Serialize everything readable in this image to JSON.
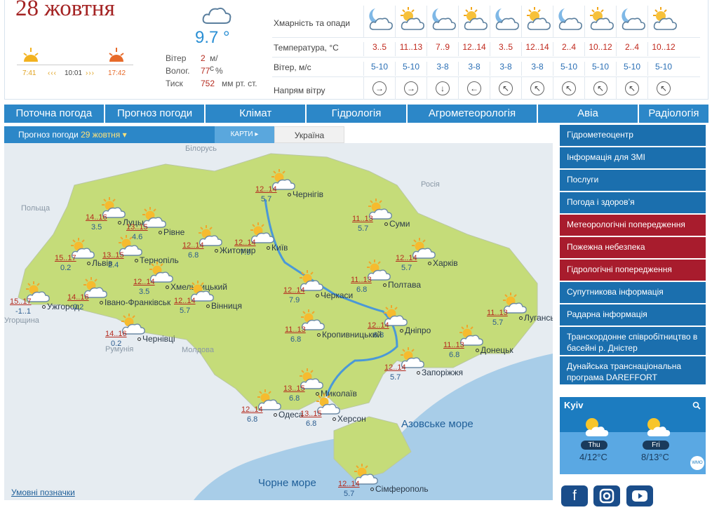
{
  "current": {
    "date": "28 жовтня",
    "temp": "9.7 °",
    "wind_label": "Вітер",
    "wind_value": "2",
    "wind_unit": "м/с",
    "hum_label": "Волог.",
    "hum_value": "77",
    "hum_unit": "%",
    "press_label": "Тиск",
    "press_value": "752",
    "press_unit": "мм рт. ст.",
    "sunrise": "7:41",
    "daylength": "10:01",
    "sunset": "17:42"
  },
  "forecast": {
    "row_labels": [
      "Хмарність та опади",
      "Температура, °C",
      "Вітер, м/с",
      "Напрям вітру"
    ],
    "temps": [
      "3..5",
      "11..13",
      "7..9",
      "12..14",
      "3..5",
      "12..14",
      "2..4",
      "10..12",
      "2..4",
      "10..12"
    ],
    "winds": [
      "5-10",
      "5-10",
      "3-8",
      "3-8",
      "3-8",
      "3-8",
      "5-10",
      "5-10",
      "5-10",
      "5-10"
    ],
    "icons": [
      "moon-cloud",
      "sun-cloud",
      "moon-cloud",
      "sun-cloud",
      "moon-cloud",
      "sun-cloud",
      "moon-cloud",
      "sun-cloud",
      "moon-cloud",
      "sun-cloud"
    ],
    "directions": [
      "→",
      "→",
      "↓",
      "←",
      "↖",
      "↖",
      "↖",
      "↖",
      "↖",
      "↖"
    ]
  },
  "nav": [
    "Поточна погода",
    "Прогноз погоди",
    "Клімат",
    "Гідрологія",
    "Агрометеорологія",
    "Авіа",
    "Радіологія"
  ],
  "map": {
    "tab_label": "Прогноз погоди",
    "tab_date": "29 жовтня",
    "tab_maps": "КАРТИ",
    "tab_country": "Україна",
    "legend": "Умовні позначки",
    "countries": [
      "Білорусь",
      "Польща",
      "Росія",
      "Угорщина",
      "Румунія",
      "Молдова"
    ],
    "seas": [
      "Азовське море",
      "Чорне море"
    ],
    "cities": [
      {
        "name": "Чернігів",
        "night": "12..14",
        "day": "5.7"
      },
      {
        "name": "Луцьк",
        "night": "14..16",
        "day": "3.5"
      },
      {
        "name": "Рівне",
        "night": "13..15",
        "day": "4.6"
      },
      {
        "name": "Київ",
        "night": "12..14",
        "day": "7.9"
      },
      {
        "name": "Суми",
        "night": "11..13",
        "day": "5.7"
      },
      {
        "name": "Житомир",
        "night": "12..14",
        "day": "6.8"
      },
      {
        "name": "Львів",
        "night": "15..17",
        "day": "0.2"
      },
      {
        "name": "Тернопіль",
        "night": "13..15",
        "day": "2.4"
      },
      {
        "name": "Харків",
        "night": "12..14",
        "day": "5.7"
      },
      {
        "name": "Хмельницький",
        "night": "12..14",
        "day": "3.5"
      },
      {
        "name": "Полтава",
        "night": "11..13",
        "day": "6.8"
      },
      {
        "name": "Черкаси",
        "night": "12..14",
        "day": "7.9"
      },
      {
        "name": "Ужгород",
        "night": "15..17",
        "day": "-1..1"
      },
      {
        "name": "Івано-Франківськ",
        "night": "14..16",
        "day": "0.2"
      },
      {
        "name": "Вінниця",
        "night": "12..14",
        "day": "5.7"
      },
      {
        "name": "Луганськ",
        "night": "11..13",
        "day": "5.7"
      },
      {
        "name": "Дніпро",
        "night": "12..14",
        "day": "6.8"
      },
      {
        "name": "Кропивницький",
        "night": "11..13",
        "day": "6.8"
      },
      {
        "name": "Чернівці",
        "night": "14..16",
        "day": "0.2"
      },
      {
        "name": "Донецьк",
        "night": "11..13",
        "day": "6.8"
      },
      {
        "name": "Запоріжжя",
        "night": "12..14",
        "day": "5.7"
      },
      {
        "name": "Миколаїв",
        "night": "13..15",
        "day": "6.8"
      },
      {
        "name": "Одеса",
        "night": "12..14",
        "day": "6.8"
      },
      {
        "name": "Херсон",
        "night": "13..15",
        "day": "6.8"
      },
      {
        "name": "Сімферополь",
        "night": "12..14",
        "day": "5.7"
      }
    ]
  },
  "sidebar": [
    {
      "label": "Гідрометеоцентр",
      "color": "blue"
    },
    {
      "label": "Інформація для ЗМІ",
      "color": "blue"
    },
    {
      "label": "Послуги",
      "color": "blue"
    },
    {
      "label": "Погода і здоров’я",
      "color": "blue"
    },
    {
      "label": "Метеорологічні попередження",
      "color": "red"
    },
    {
      "label": "Пожежна небезпека",
      "color": "red"
    },
    {
      "label": "Гідрологічні попередження",
      "color": "red"
    },
    {
      "label": "Супутникова інформація",
      "color": "blue"
    },
    {
      "label": "Радарна інформація",
      "color": "blue"
    },
    {
      "label": "Транскордонне співробітництво в басейні р. Дністер",
      "color": "blue"
    },
    {
      "label": "Дунайська транснаціональна програма DAREFFORT",
      "color": "blue"
    }
  ],
  "widget": {
    "city": "Kyiv",
    "days": [
      {
        "day": "Thu",
        "temps": "4/12°C"
      },
      {
        "day": "Fri",
        "temps": "8/13°C"
      }
    ],
    "badge": "WMO"
  },
  "social": [
    "f",
    "instagram",
    "youtube"
  ],
  "colors": {
    "accent": "#2c87c8",
    "date": "#a42323",
    "warning": "#a81c2d",
    "temp": "#c0281c"
  }
}
